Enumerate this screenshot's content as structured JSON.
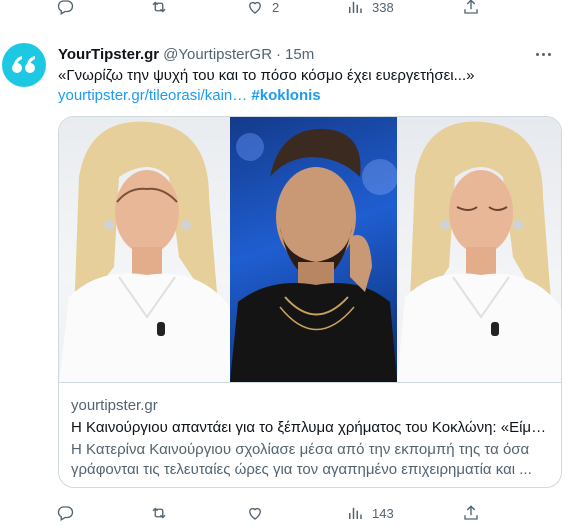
{
  "prev_tweet_actions": {
    "reply": {
      "icon": "reply-icon",
      "count": ""
    },
    "retweet": {
      "icon": "retweet-icon",
      "count": ""
    },
    "like": {
      "icon": "heart-icon",
      "count": "2"
    },
    "views": {
      "icon": "views-icon",
      "count": "338"
    },
    "share": {
      "icon": "share-icon",
      "count": ""
    }
  },
  "tweet": {
    "author_name": "YourTipster.gr",
    "handle": "@YourtipsterGR",
    "separator": "·",
    "time": "15m",
    "text": "«Γνωρίζω την ψυχή του και το πόσο κόσμο έχει ευεργετήσει...»",
    "link": "yourtipster.gr/tileorasi/kain…",
    "hashtag": "#koklonis",
    "avatar_icon": "quote-mark-icon",
    "avatar_color": "#1dc8e3",
    "card": {
      "domain": "yourtipster.gr",
      "title": "Η Καινούργιου απαντάει για το ξέπλυμα χρήματος του Κοκλώνη: «Είμαι ...",
      "description": "Η Κατερίνα Καινούργιου σχολίασε μέσα από την εκπομπή της τα όσα γράφονται τις τελευταίες ώρες για τον αγαπημένο επιχειρηματία και ..."
    },
    "actions": {
      "reply": {
        "icon": "reply-icon",
        "count": ""
      },
      "retweet": {
        "icon": "retweet-icon",
        "count": ""
      },
      "like": {
        "icon": "heart-icon",
        "count": ""
      },
      "views": {
        "icon": "views-icon",
        "count": "143"
      },
      "share": {
        "icon": "share-icon",
        "count": ""
      }
    }
  },
  "colors": {
    "link": "#1d9bf0",
    "secondary_text": "#536471",
    "border": "#cfd9de"
  }
}
